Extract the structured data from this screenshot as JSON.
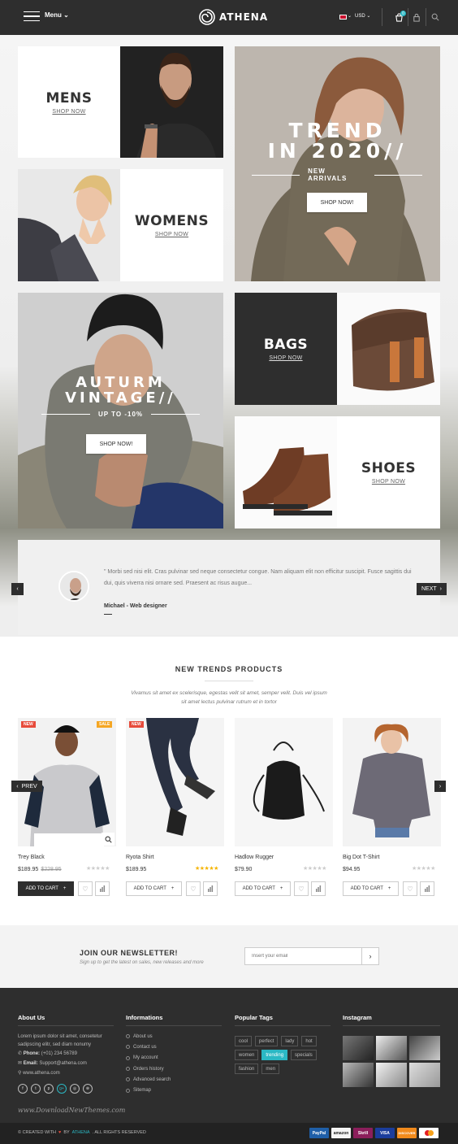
{
  "header": {
    "menu": "Menu",
    "logo": "ATHENA",
    "currency": "USD",
    "cart_count": "0"
  },
  "banners": {
    "mens": {
      "title": "MENS",
      "link": "SHOP NOW"
    },
    "womens": {
      "title": "WOMENS",
      "link": "SHOP NOW"
    },
    "trend": {
      "line1": "TREND",
      "line2": "IN 2020//",
      "sub": "NEW ARRIVALS",
      "button": "SHOP NOW!"
    },
    "autumn": {
      "line1": "AUTURM",
      "line2": "VINTAGE//",
      "sub": "UP TO -10%",
      "button": "SHOP NOW!"
    },
    "bags": {
      "title": "BAGS",
      "link": "SHOP NOW"
    },
    "shoes": {
      "title": "SHOES",
      "link": "SHOP NOW"
    }
  },
  "testimonial": {
    "quote": "\" Morbi sed nisi elit. Cras pulvinar sed neque consectetur congue. Nam aliquam elit non efficitur suscipit. Fusce sagittis dui dui, quis viverra nisi ornare sed. Praesent ac risus augue...",
    "author": "Michael - Web designer",
    "prev": "‹",
    "next": "NEXT"
  },
  "products": {
    "title": "NEW TRENDS PRODUCTS",
    "subtitle": "Vivamus sit amet ex scelerisque, egestas velit sit amet, semper velit. Duis vel ipsum sit amet lectus pulvinar rutrum et in tortor",
    "prev": "PREV",
    "add_to_cart": "ADD TO CART",
    "items": [
      {
        "name": "Trey Black",
        "price": "$189.95",
        "old_price": "$228.95",
        "badge": "NEW",
        "badge2": "SALE",
        "rating": 0
      },
      {
        "name": "Ryota Shirt",
        "price": "$189.95",
        "old_price": "",
        "badge": "NEW",
        "badge2": "",
        "rating": 5
      },
      {
        "name": "Hadlow Rugger",
        "price": "$79.90",
        "old_price": "",
        "badge": "",
        "badge2": "",
        "rating": 0
      },
      {
        "name": "Big Dot T-Shirt",
        "price": "$94.95",
        "old_price": "",
        "badge": "",
        "badge2": "",
        "rating": 0
      }
    ]
  },
  "newsletter": {
    "title": "JOIN OUR NEWSLETTER!",
    "subtitle": "Sign up to get the latest on sales, new releases and more",
    "placeholder": "Insert your email"
  },
  "footer": {
    "about": {
      "title": "About Us",
      "text": "Lorem ipsum dolor sit amet, consetetur sadipscing elitr, sed diam nonumy",
      "phone_label": "Phone:",
      "phone": "(+01) 234 56789",
      "email_label": "Email:",
      "email": "Support@athena.com",
      "web": "www.athena.com"
    },
    "info": {
      "title": "Informations",
      "links": [
        "About us",
        "Contact us",
        "My account",
        "Orders history",
        "Advanced search",
        "Sitemap"
      ]
    },
    "tags": {
      "title": "Popular Tags",
      "items": [
        "cool",
        "perfect",
        "lady",
        "hot",
        "women",
        "trending",
        "specials",
        "fashion",
        "men"
      ],
      "active": "trending"
    },
    "instagram": {
      "title": "Instagram"
    },
    "watermark": "www.DownloadNewThemes.com",
    "copyright_pre": "© CREATED WITH",
    "copyright_by": "BY",
    "copyright_brand": "ATHENA",
    "copyright_post": ". ALL RIGHTS RESERVED",
    "payments": [
      "PayPal",
      "amazon",
      "Skrill",
      "VISA",
      "DISCOVER",
      "MC"
    ]
  },
  "colors": {
    "dark": "#2e2e2e",
    "accent": "#2bb8c4",
    "sale": "#f5a623",
    "new": "#e74c3c"
  }
}
